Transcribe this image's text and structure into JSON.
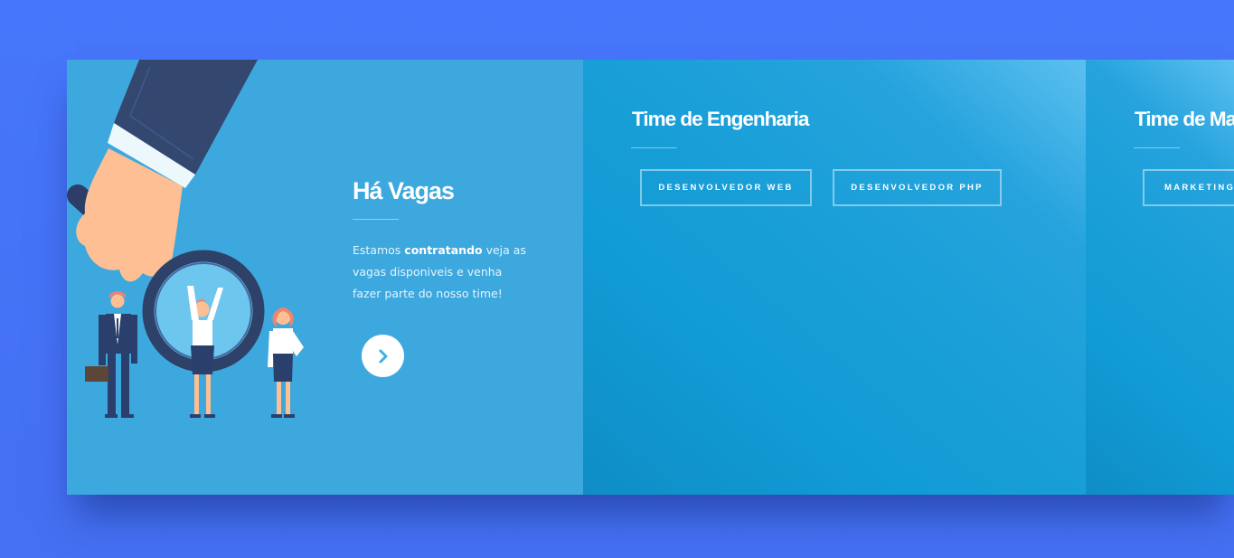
{
  "intro": {
    "title": "Há Vagas",
    "desc_before": "Estamos ",
    "desc_bold": "contratando",
    "desc_after": " veja as vagas disponiveis e venha fazer parte do nosso time!",
    "next_icon": "chevron-right-icon"
  },
  "teams": [
    {
      "title": "Time de Engenharia",
      "jobs": [
        "DESENVOLVEDOR WEB",
        "DESENVOLVEDOR PHP"
      ]
    },
    {
      "title": "Time de Ma",
      "jobs": [
        "MARKETING"
      ]
    }
  ],
  "colors": {
    "background": "#4575f8",
    "intro_panel": "#3da8de",
    "team_panel": "#119bd5",
    "accent": "#3db1e6"
  }
}
